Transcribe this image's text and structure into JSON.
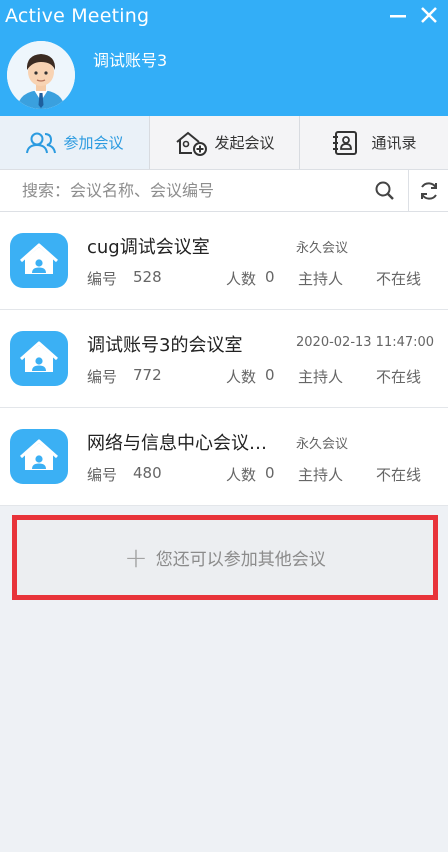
{
  "app_title": "Active Meeting",
  "user": {
    "name": "调试账号3"
  },
  "tabs": [
    {
      "label": "参加会议",
      "icon": "users-icon",
      "active": true
    },
    {
      "label": "发起会议",
      "icon": "home-add-icon",
      "active": false
    },
    {
      "label": "通讯录",
      "icon": "contacts-icon",
      "active": false
    }
  ],
  "search": {
    "placeholder": "搜索：会议名称、会议编号"
  },
  "rooms": [
    {
      "name": "cug调试会议室",
      "tag": "永久会议",
      "id_label": "编号",
      "id": "528",
      "count_label": "人数",
      "count": "0",
      "host_label": "主持人",
      "status": "不在线"
    },
    {
      "name": "调试账号3的会议室",
      "tag": "2020-02-13 11:47:00",
      "id_label": "编号",
      "id": "772",
      "count_label": "人数",
      "count": "0",
      "host_label": "主持人",
      "status": "不在线"
    },
    {
      "name": "网络与信息中心会议…",
      "tag": "永久会议",
      "id_label": "编号",
      "id": "480",
      "count_label": "人数",
      "count": "0",
      "host_label": "主持人",
      "status": "不在线"
    }
  ],
  "join_more": {
    "plus": "+",
    "label": "您还可以参加其他会议"
  },
  "colors": {
    "header": "#33aef7",
    "accent": "#2c9be0",
    "highlight_border": "#e8333a"
  }
}
